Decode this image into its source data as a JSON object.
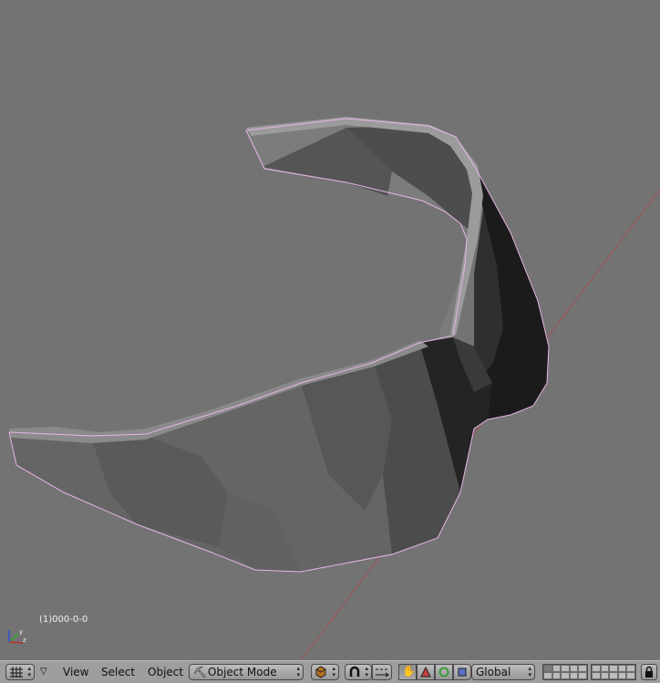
{
  "viewport": {
    "object_label": "(1)000-0-0",
    "axis_labels": {
      "x": "x",
      "y": "y",
      "z": "z"
    }
  },
  "header": {
    "editor_type_icon": "grid-icon",
    "menus": {
      "view": "View",
      "select": "Select",
      "object": "Object"
    },
    "mode": {
      "icon": "object-mode-icon",
      "label": "Object Mode"
    },
    "draw_type_icon": "shading-cube-icon",
    "pivot_icon": "magnet-icon",
    "transform": {
      "orientation": "Global"
    },
    "lock_icon": "lock-icon"
  }
}
